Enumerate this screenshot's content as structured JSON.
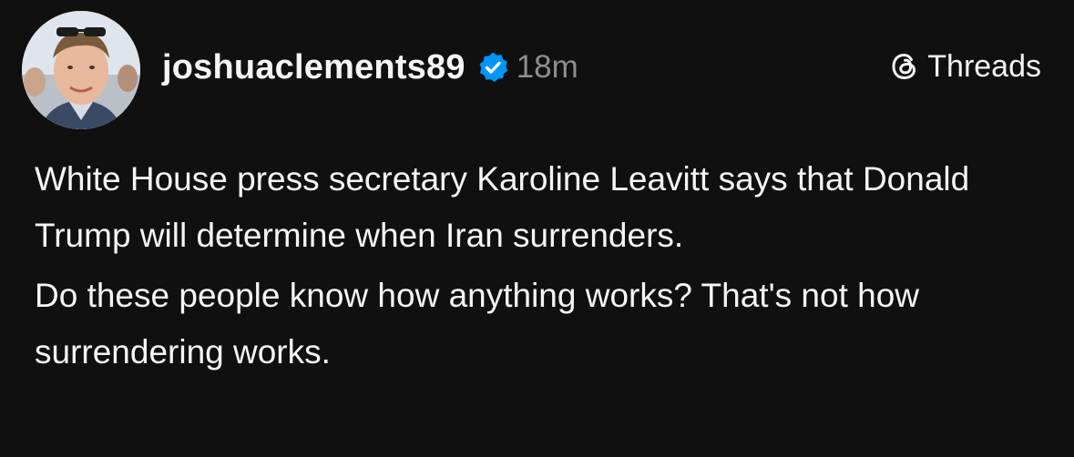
{
  "post": {
    "username": "joshuaclements89",
    "verified_icon": "verified-badge-icon",
    "timestamp": "18m",
    "brand": {
      "icon": "threads-logo-icon",
      "label": "Threads"
    },
    "paragraphs": [
      "White House press secretary Karoline Leavitt says that Donald Trump will determine when Iran surrenders.",
      "Do these people know how anything works? That's not how surrendering works."
    ]
  },
  "colors": {
    "background": "#101010",
    "text": "#f3f5f7",
    "muted": "#8e8e93",
    "verified": "#0095f6"
  }
}
